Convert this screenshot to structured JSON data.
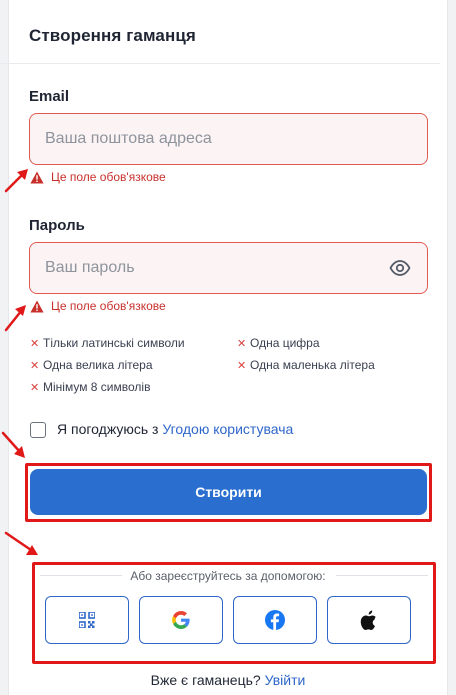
{
  "form": {
    "title": "Створення гаманця",
    "email_label": "Email",
    "email_placeholder": "Ваша поштова адреса",
    "email_value": "",
    "email_error": "Це поле обов'язкове",
    "password_label": "Пароль",
    "password_placeholder": "Ваш пароль",
    "password_value": "",
    "password_error": "Це поле обов'язкове",
    "requirements": [
      "Тільки латинські символи",
      "Одна цифра",
      "Одна велика літера",
      "Одна маленька літера",
      "Мінімум 8 символів"
    ],
    "agree_prefix": "Я погоджуюсь з ",
    "agree_link": "Угодою користувача",
    "agree_checked": false,
    "create_button": "Створити"
  },
  "social": {
    "divider_text": "Або зареєструйтесь за допомогою:",
    "buttons": [
      "qr-code-icon",
      "google-icon",
      "facebook-icon",
      "apple-icon"
    ]
  },
  "footer": {
    "question": "Вже є гаманець?",
    "login_link": "Увійти"
  },
  "colors": {
    "accent": "#2a6fcf",
    "error": "#c8302c",
    "error_border": "#e05a52",
    "annotation": "#e01818"
  },
  "annotations": {
    "highlights": [
      "create-button",
      "social-login-section"
    ],
    "arrows": 4
  }
}
